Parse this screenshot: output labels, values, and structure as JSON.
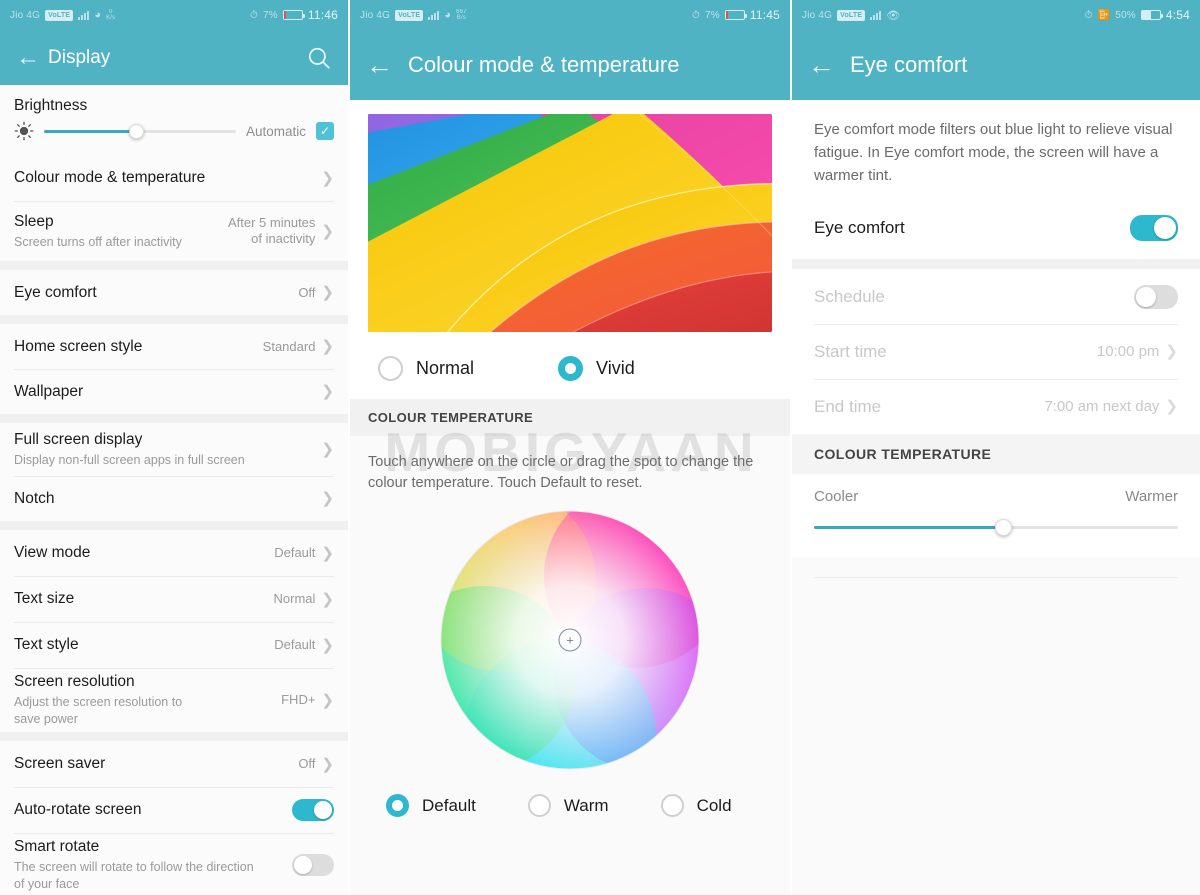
{
  "panel1": {
    "status": {
      "carrier": "Jio 4G",
      "volte": "VoLTE",
      "net_speed_value": "0",
      "net_speed_unit": "K/s",
      "battery_percent": "7%",
      "time": "11:46"
    },
    "appbar": {
      "title": "Display",
      "back_icon": "back-arrow-icon",
      "search_icon": "search-icon"
    },
    "brightness": {
      "label": "Brightness",
      "auto_label": "Automatic",
      "auto_checked": true,
      "slider_percent": 48
    },
    "items": [
      {
        "title": "Colour mode & temperature",
        "sub": "",
        "value": "",
        "chevron": true
      },
      {
        "title": "Sleep",
        "sub": "Screen turns off after inactivity",
        "value": "After 5 minutes\nof inactivity",
        "chevron": true
      },
      {
        "title": "Eye comfort",
        "sub": "",
        "value": "Off",
        "chevron": true
      },
      {
        "title": "Home screen style",
        "sub": "",
        "value": "Standard",
        "chevron": true
      },
      {
        "title": "Wallpaper",
        "sub": "",
        "value": "",
        "chevron": true
      },
      {
        "title": "Full screen display",
        "sub": "Display non-full screen apps in full screen",
        "value": "",
        "chevron": true
      },
      {
        "title": "Notch",
        "sub": "",
        "value": "",
        "chevron": true
      },
      {
        "title": "View mode",
        "sub": "",
        "value": "Default",
        "chevron": true
      },
      {
        "title": "Text size",
        "sub": "",
        "value": "Normal",
        "chevron": true
      },
      {
        "title": "Text style",
        "sub": "",
        "value": "Default",
        "chevron": true
      },
      {
        "title": "Screen resolution",
        "sub": "Adjust the screen resolution to\nsave power",
        "value": "FHD+",
        "chevron": true
      },
      {
        "title": "Screen saver",
        "sub": "",
        "value": "Off",
        "chevron": true
      },
      {
        "title": "Auto-rotate screen",
        "sub": "",
        "value": "",
        "toggle": "on"
      },
      {
        "title": "Smart rotate",
        "sub": "The screen will rotate to follow the direction\nof your face",
        "value": "",
        "toggle": "off"
      }
    ]
  },
  "panel2": {
    "status": {
      "carrier": "Jio 4G",
      "volte": "VoLTE",
      "net_speed_value": "667",
      "net_speed_unit": "B/s",
      "battery_percent": "7%",
      "time": "11:45"
    },
    "appbar": {
      "title": "Colour mode & temperature",
      "back_icon": "back-arrow-icon"
    },
    "mode_options": [
      {
        "label": "Normal",
        "selected": false
      },
      {
        "label": "Vivid",
        "selected": true
      }
    ],
    "section_header": "COLOUR TEMPERATURE",
    "help_text": "Touch anywhere on the circle or drag the spot to change the colour temperature. Touch Default to reset.",
    "temp_options": [
      {
        "label": "Default",
        "selected": true
      },
      {
        "label": "Warm",
        "selected": false
      },
      {
        "label": "Cold",
        "selected": false
      }
    ],
    "watermark": "MOBIGYAAN"
  },
  "panel3": {
    "status": {
      "carrier": "Jio 4G",
      "volte": "VoLTE",
      "battery_percent": "50%",
      "time": "4:54"
    },
    "appbar": {
      "title": "Eye comfort",
      "back_icon": "back-arrow-icon"
    },
    "description": "Eye comfort mode filters out blue light to relieve visual fatigue. In Eye comfort mode, the screen will have a warmer tint.",
    "main_toggle": {
      "label": "Eye comfort",
      "state": "on"
    },
    "items": [
      {
        "title": "Schedule",
        "value": "",
        "toggle": "off",
        "dim": true
      },
      {
        "title": "Start time",
        "value": "10:00 pm",
        "chevron": true,
        "dim": true
      },
      {
        "title": "End time",
        "value": "7:00 am next day",
        "chevron": true,
        "dim": true
      }
    ],
    "section_header": "COLOUR TEMPERATURE",
    "temperature": {
      "cooler_label": "Cooler",
      "warmer_label": "Warmer",
      "slider_percent": 52
    }
  },
  "colors": {
    "accent": "#4fb3c4",
    "toggle_on": "#2eb8cd",
    "slider_fill": "#3aa9bd",
    "checkbox": "#4fc2d4"
  }
}
